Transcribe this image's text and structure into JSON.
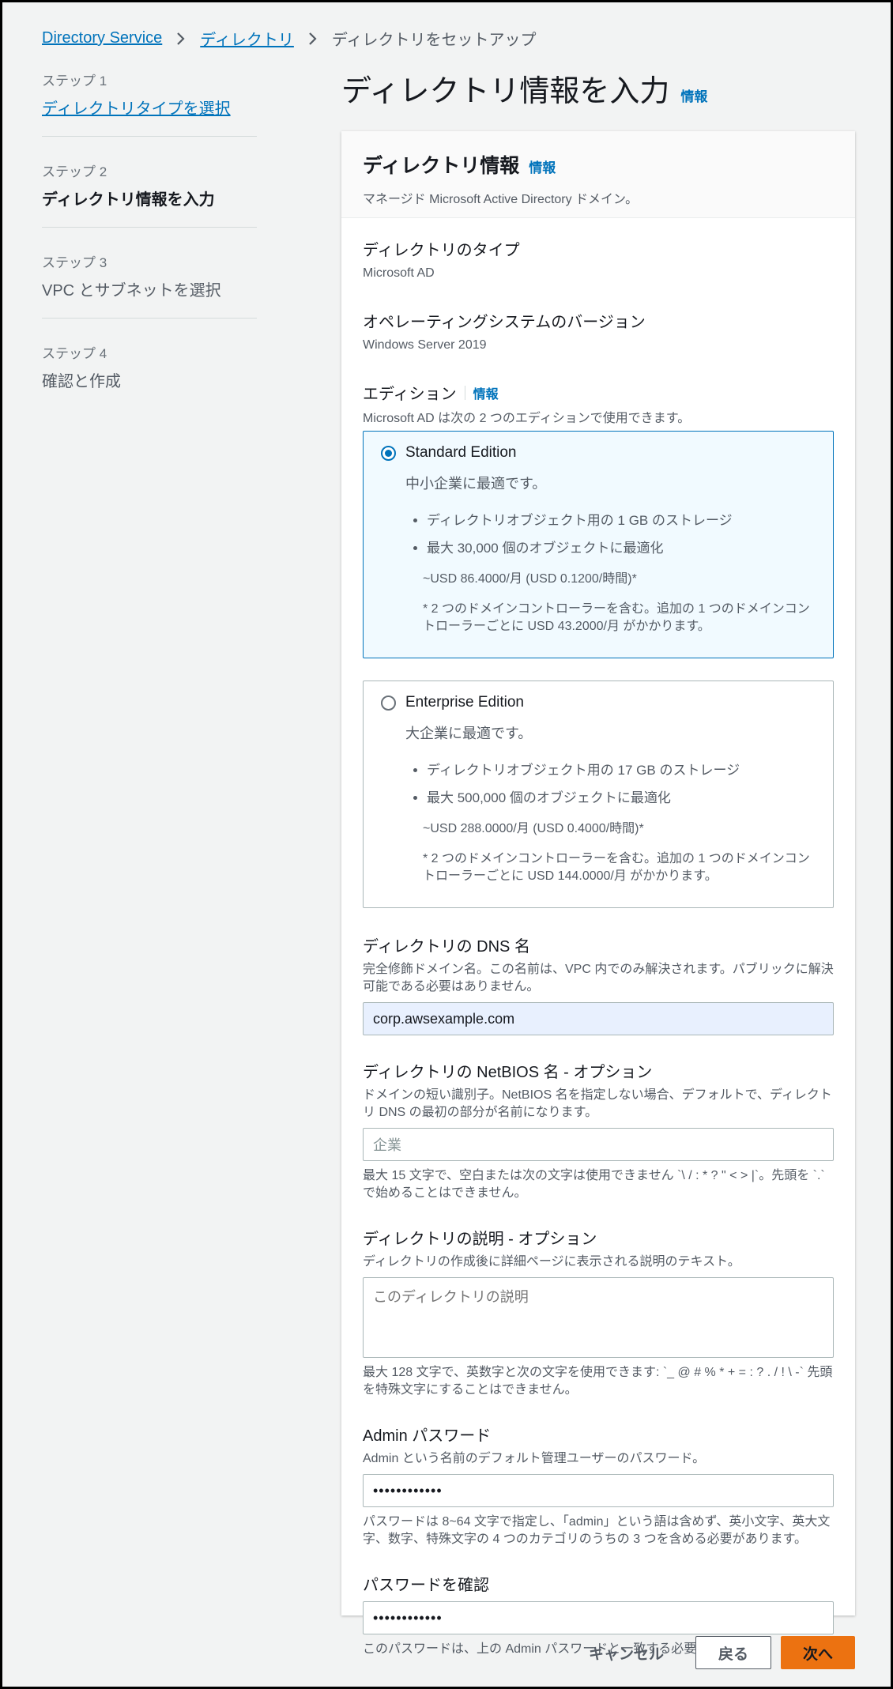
{
  "breadcrumb": {
    "items": [
      "Directory Service",
      "ディレクトリ",
      "ディレクトリをセットアップ"
    ]
  },
  "steps": [
    {
      "num": "ステップ 1",
      "title": "ディレクトリタイプを選択"
    },
    {
      "num": "ステップ 2",
      "title": "ディレクトリ情報を入力"
    },
    {
      "num": "ステップ 3",
      "title": "VPC とサブネットを選択"
    },
    {
      "num": "ステップ 4",
      "title": "確認と作成"
    }
  ],
  "page": {
    "title": "ディレクトリ情報を入力",
    "info": "情報"
  },
  "panel": {
    "title": "ディレクトリ情報",
    "info": "情報",
    "description": "マネージド Microsoft Active Directory ドメイン。",
    "dir_type_label": "ディレクトリのタイプ",
    "dir_type_value": "Microsoft AD",
    "os_label": "オペレーティングシステムのバージョン",
    "os_value": "Windows Server 2019",
    "edition_label": "エディション",
    "edition_info": "情報",
    "edition_desc": "Microsoft AD は次の 2 つのエディションで使用できます。"
  },
  "editions": [
    {
      "title": "Standard Edition",
      "subtitle": "中小企業に最適です。",
      "bullets": [
        "ディレクトリオブジェクト用の 1 GB のストレージ",
        "最大 30,000 個のオブジェクトに最適化"
      ],
      "price": "~USD 86.4000/月 (USD 0.1200/時間)*",
      "note": "* 2 つのドメインコントローラーを含む。追加の 1 つのドメインコントローラーごとに USD 43.2000/月 がかかります。",
      "selected": true
    },
    {
      "title": "Enterprise Edition",
      "subtitle": "大企業に最適です。",
      "bullets": [
        "ディレクトリオブジェクト用の 17 GB のストレージ",
        "最大 500,000 個のオブジェクトに最適化"
      ],
      "price": "~USD 288.0000/月 (USD 0.4000/時間)*",
      "note": "* 2 つのドメインコントローラーを含む。追加の 1 つのドメインコントローラーごとに USD 144.0000/月 がかかります。",
      "selected": false
    }
  ],
  "fields": {
    "dns": {
      "label": "ディレクトリの DNS 名",
      "help": "完全修飾ドメイン名。この名前は、VPC 内でのみ解決されます。パブリックに解決可能である必要はありません。",
      "value": "corp.awsexample.com"
    },
    "netbios": {
      "label": "ディレクトリの NetBIOS 名 - オプション",
      "help": "ドメインの短い識別子。NetBIOS 名を指定しない場合、デフォルトで、ディレクトリ DNS の最初の部分が名前になります。",
      "placeholder": "企業",
      "constraint": "最大 15 文字で、空白または次の文字は使用できません `\\ / : * ? \" < > |`。先頭を `.` で始めることはできません。"
    },
    "description": {
      "label": "ディレクトリの説明 - オプション",
      "help": "ディレクトリの作成後に詳細ページに表示される説明のテキスト。",
      "placeholder": "このディレクトリの説明",
      "constraint": "最大 128 文字で、英数字と次の文字を使用できます: `_ @ # % * + = : ? . / ! \\ -` 先頭を特殊文字にすることはできません。"
    },
    "admin_password": {
      "label": "Admin パスワード",
      "help": "Admin という名前のデフォルト管理ユーザーのパスワード。",
      "value": "••••••••••••",
      "constraint": "パスワードは 8~64 文字で指定し、「admin」という語は含めず、英小文字、英大文字、数字、特殊文字の 4 つのカテゴリのうちの 3 つを含める必要があります。"
    },
    "confirm_password": {
      "label": "パスワードを確認",
      "value": "••••••••••••",
      "constraint": "このパスワードは、上の Admin パスワードと一致する必要があります。"
    }
  },
  "footer": {
    "cancel": "キャンセル",
    "back": "戻る",
    "next": "次へ"
  },
  "colors": {
    "link": "#0073bb",
    "primary": "#ec7211",
    "selected_bg": "#f1faff"
  }
}
